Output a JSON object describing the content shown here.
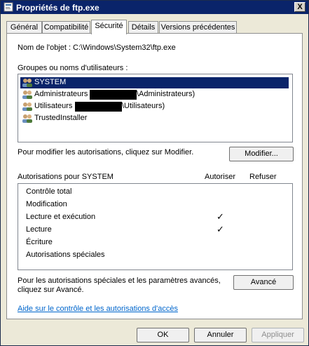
{
  "window": {
    "title": "Propriétés de ftp.exe",
    "close_label": "X"
  },
  "tabs": [
    {
      "label": "Général"
    },
    {
      "label": "Compatibilité"
    },
    {
      "label": "Sécurité"
    },
    {
      "label": "Détails"
    },
    {
      "label": "Versions précédentes"
    }
  ],
  "object": {
    "label": "Nom de l'objet :",
    "value": "C:\\Windows\\System32\\ftp.exe"
  },
  "groups": {
    "label": "Groupes ou noms d'utilisateurs :",
    "items": [
      {
        "label": "SYSTEM",
        "suffix": ""
      },
      {
        "label": "Administrateurs",
        "suffix": "\\Administrateurs)"
      },
      {
        "label": "Utilisateurs",
        "suffix": "\\Utilisateurs)"
      },
      {
        "label": "TrustedInstaller",
        "suffix": ""
      }
    ]
  },
  "modify": {
    "text": "Pour modifier les autorisations, cliquez sur Modifier.",
    "button": "Modifier..."
  },
  "permissions": {
    "header": "Autorisations pour SYSTEM",
    "col_allow": "Autoriser",
    "col_deny": "Refuser",
    "check_glyph": "✓",
    "items": [
      {
        "label": "Contrôle total"
      },
      {
        "label": "Modification"
      },
      {
        "label": "Lecture et exécution"
      },
      {
        "label": "Lecture"
      },
      {
        "label": "Écriture"
      },
      {
        "label": "Autorisations spéciales"
      }
    ]
  },
  "advanced": {
    "line1": "Pour les autorisations spéciales et les paramètres avancés,",
    "line2": "cliquez sur Avancé.",
    "button": "Avancé"
  },
  "help_link": "Aide sur le contrôle et les autorisations d'accès",
  "footer": {
    "ok": "OK",
    "cancel": "Annuler",
    "apply": "Appliquer"
  }
}
